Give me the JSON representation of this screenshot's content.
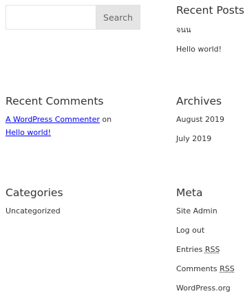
{
  "search": {
    "placeholder": "",
    "button_label": "Search"
  },
  "recent_posts": {
    "title": "Recent Posts",
    "items": [
      "จนน",
      "Hello world!"
    ]
  },
  "recent_comments": {
    "title": "Recent Comments",
    "author": "A WordPress Commenter",
    "on_text": " on ",
    "post": "Hello world!"
  },
  "archives": {
    "title": "Archives",
    "items": [
      "August 2019",
      "July 2019"
    ]
  },
  "categories": {
    "title": "Categories",
    "items": [
      "Uncategorized"
    ]
  },
  "meta": {
    "title": "Meta",
    "site_admin": "Site Admin",
    "log_out": "Log out",
    "entries_prefix": "Entries ",
    "comments_prefix": "Comments ",
    "rss": "RSS",
    "wordpress_org": "WordPress.org"
  }
}
